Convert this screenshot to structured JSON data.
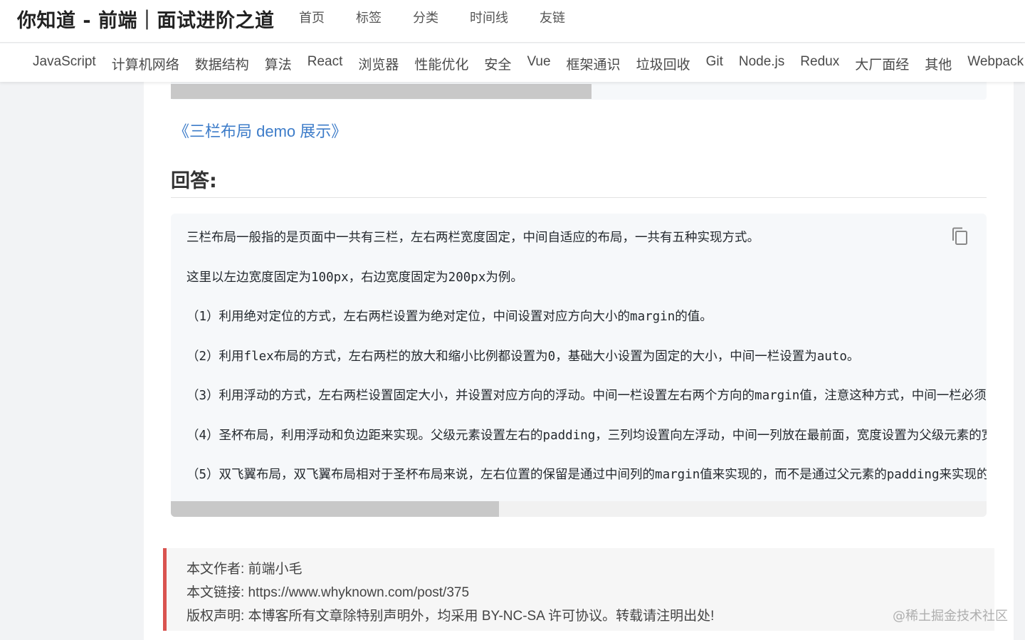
{
  "header": {
    "site_title": "你知道 - 前端｜面试进阶之道",
    "nav": [
      "首页",
      "标签",
      "分类",
      "时间线",
      "友链"
    ]
  },
  "tags": [
    "JavaScript",
    "计算机网络",
    "数据结构",
    "算法",
    "React",
    "浏览器",
    "性能优化",
    "安全",
    "Vue",
    "框架通识",
    "垃圾回收",
    "Git",
    "Node.js",
    "Redux",
    "大厂面经",
    "其他",
    "Webpack"
  ],
  "article": {
    "demo_link": "《三栏布局 demo 展示》",
    "answer_heading": "回答:",
    "code_lines": [
      "三栏布局一般指的是页面中一共有三栏，左右两栏宽度固定，中间自适应的布局，一共有五种实现方式。",
      "这里以左边宽度固定为100px，右边宽度固定为200px为例。",
      "（1）利用绝对定位的方式，左右两栏设置为绝对定位，中间设置对应方向大小的margin的值。",
      "（2）利用flex布局的方式，左右两栏的放大和缩小比例都设置为0，基础大小设置为固定的大小，中间一栏设置为auto。",
      "（3）利用浮动的方式，左右两栏设置固定大小，并设置对应方向的浮动。中间一栏设置左右两个方向的margin值，注意这种方式，中间一栏必须放到最后。",
      "（4）圣杯布局，利用浮动和负边距来实现。父级元素设置左右的padding，三列均设置向左浮动，中间一列放在最前面，宽度设置为父级元素的宽度。",
      "（5）双飞翼布局，双飞翼布局相对于圣杯布局来说，左右位置的保留是通过中间列的margin值来实现的，而不是通过父元素的padding来实现的。"
    ],
    "copyright": {
      "author_line": "本文作者:  前端小毛",
      "link_line": "本文链接:  https://www.whyknown.com/post/375",
      "license_line": "版权声明:  本博客所有文章除特别声明外，均采用 BY-NC-SA 许可协议。转载请注明出处!"
    }
  },
  "watermark": "@稀土掘金技术社区",
  "colors": {
    "link": "#3d7cc9",
    "copyright_border": "#d9534f",
    "code_bg": "#f6f8fa"
  },
  "icons": {
    "copy": "copy-icon"
  }
}
